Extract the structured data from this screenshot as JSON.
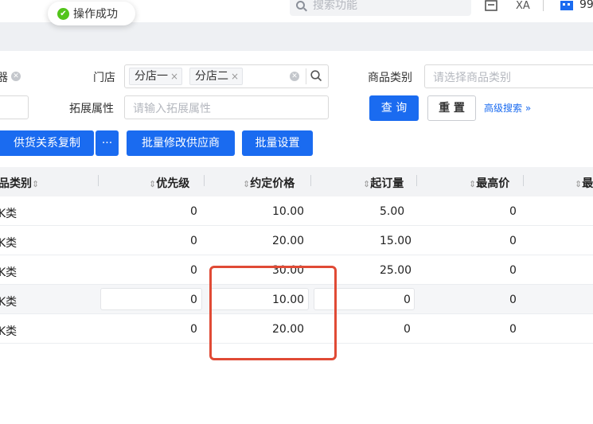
{
  "toast": {
    "text": "操作成功"
  },
  "topbar": {
    "search_placeholder": "搜索功能",
    "lang_icon_text": "XA",
    "count": "99"
  },
  "filters": {
    "store_label": "门店",
    "store_tags": [
      "分店一",
      "分店二"
    ],
    "category_label": "商品类别",
    "category_placeholder": "请选择商品类别",
    "ext_label": "拓展属性",
    "ext_placeholder": "请输入拓展属性",
    "left_cut": "器"
  },
  "buttons": {
    "query": "查 询",
    "reset": "重 置",
    "advanced": "高级搜索",
    "copy_supply": "供货关系复制",
    "more": "···",
    "batch_supplier": "批量修改供应商",
    "batch_set": "批量设置"
  },
  "table": {
    "headers": [
      "品类别",
      "优先级",
      "约定价格",
      "起订量",
      "最高价",
      "最"
    ],
    "rows": [
      {
        "cat": "K类",
        "priority": "0",
        "price": "10.00",
        "moq": "5.00",
        "max": "0"
      },
      {
        "cat": "K类",
        "priority": "0",
        "price": "20.00",
        "moq": "15.00",
        "max": "0"
      },
      {
        "cat": "K类",
        "priority": "0",
        "price": "30.00",
        "moq": "25.00",
        "max": "0"
      },
      {
        "cat": "K类",
        "priority": "0",
        "price": "10.00",
        "moq": "0",
        "max": "0"
      },
      {
        "cat": "K类",
        "priority": "0",
        "price": "20.00",
        "moq": "0",
        "max": "0"
      }
    ]
  },
  "colors": {
    "primary": "#1a6bf0",
    "highlight": "#e04a35",
    "success": "#52c41a"
  }
}
